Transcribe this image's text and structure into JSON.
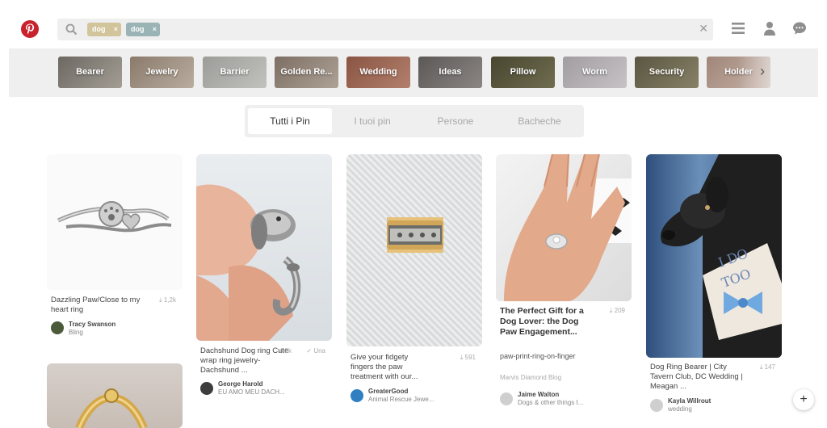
{
  "header": {
    "logo_icon": "pinterest-logo-icon",
    "search": {
      "chips": [
        {
          "label": "dog",
          "color": "#d2c49b"
        },
        {
          "label": "dog",
          "color": "#9ab3b5"
        }
      ],
      "chip_remove": "×",
      "clear": "✕"
    },
    "icons": [
      "menu-icon",
      "user-icon",
      "chat-icon"
    ]
  },
  "categories": [
    {
      "label": "Bearer",
      "color": "#8e8a84"
    },
    {
      "label": "Jewelry",
      "color": "#a3968a"
    },
    {
      "label": "Barrier",
      "color": "#a7a7a4"
    },
    {
      "label": "Golden Re...",
      "color": "#9a8d83"
    },
    {
      "label": "Wedding",
      "color": "#9e6d5a"
    },
    {
      "label": "Ideas",
      "color": "#777270"
    },
    {
      "label": "Pillow",
      "color": "#5c5a40"
    },
    {
      "label": "Worm",
      "color": "#b0acaf"
    },
    {
      "label": "Security",
      "color": "#706b54"
    },
    {
      "label": "Holder",
      "color": "#b39d91"
    }
  ],
  "tabs": [
    {
      "label": "Tutti i Pin",
      "active": true
    },
    {
      "label": "I tuoi pin",
      "active": false
    },
    {
      "label": "Persone",
      "active": false
    },
    {
      "label": "Bacheche",
      "active": false
    }
  ],
  "pins": [
    {
      "title": "Dazzling Paw/Close to my heart ring",
      "saves": "1,2k",
      "user": "Tracy Swanson",
      "board": "Bling"
    },
    {
      "title": "Dachshund Dog ring Cute wrap ring jewelry-Dachshund ...",
      "saves": "4,2k",
      "extra": "Una",
      "user": "George Harold",
      "board": "EU AMO MEU DACH..."
    },
    {
      "title": "Give your fidgety fingers the paw treatment with our...",
      "saves": "591",
      "user": "GreaterGood",
      "board": "Animal Rescue Jewe..."
    },
    {
      "title": "The Perfect Gift for a Dog Lover: the Dog Paw Engagement...",
      "saves": "209",
      "desc": "paw-print-ring-on-finger",
      "source": "Marvis Diamond Blog",
      "user": "Jaime Walton",
      "board": "Dogs & other things I..."
    },
    {
      "title": "Dog Ring Bearer | City Tavern Club, DC Wedding | Meagan ...",
      "saves": "147",
      "user": "Kayla Willrout",
      "board": "wedding",
      "image_text": "I DO TOO"
    }
  ],
  "fab": "+"
}
